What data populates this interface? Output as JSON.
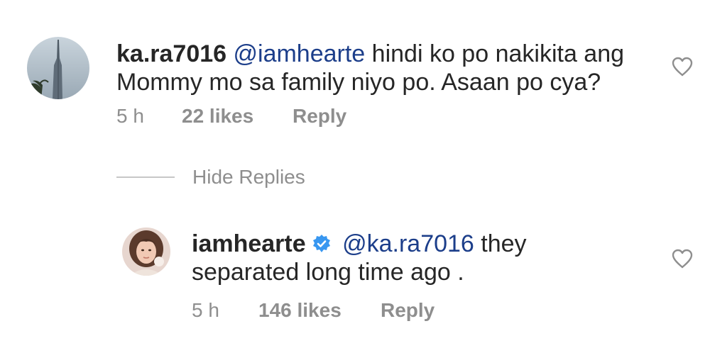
{
  "comments": [
    {
      "avatar": "tower-photo-avatar",
      "username": "ka.ra7016",
      "mention": "@iamhearte",
      "text_line1": " hindi ko po nakikita ang",
      "text_line2": "Mommy mo sa family niyo po. Asaan po cya?",
      "time": "5 h",
      "likes": "22 likes",
      "reply": "Reply",
      "verified": false
    }
  ],
  "replies_toggle": {
    "label": "Hide Replies"
  },
  "replies": [
    {
      "avatar": "woman-portrait-avatar",
      "username": "iamhearte",
      "verified": true,
      "verified_color": "#3897f0",
      "mention": "@ka.ra7016",
      "text_line1": " they",
      "text_line2": "separated long time ago .",
      "time": "5 h",
      "likes": "146 likes",
      "reply": "Reply"
    }
  ],
  "colors": {
    "text": "#262626",
    "mention": "#1c3e8a",
    "meta": "#8e8e8e",
    "divider": "#c7c7c7",
    "background": "#ffffff"
  }
}
